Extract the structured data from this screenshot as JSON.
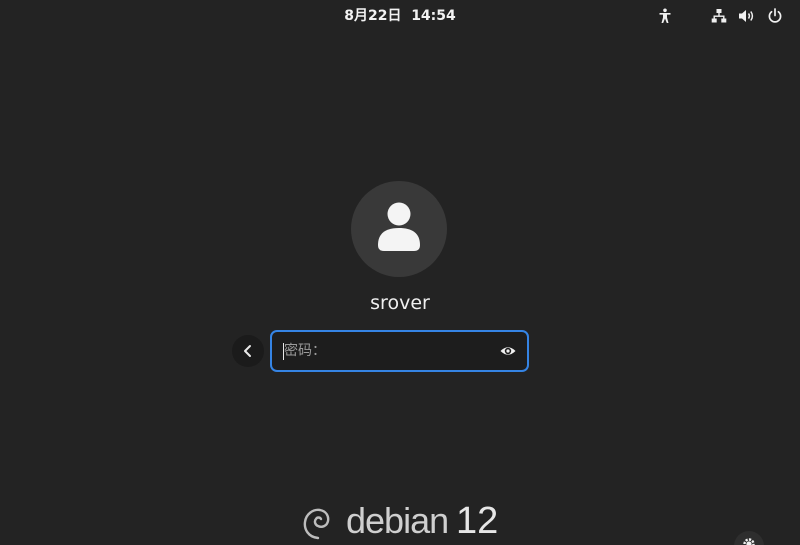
{
  "top_bar": {
    "clock": "8月22日  14:54",
    "icons": [
      "accessibility-icon",
      "network-icon",
      "volume-icon",
      "power-icon"
    ]
  },
  "login": {
    "avatar_icon": "user-icon",
    "username": "srover",
    "back_icon": "chevron-left-icon",
    "password_placeholder": "密码：",
    "password_value": "",
    "reveal_icon": "eye-icon"
  },
  "branding": {
    "logo_icon": "debian-swirl-icon",
    "name": "debian",
    "version": "12"
  },
  "session_settings_icon": "gear-icon",
  "colors": {
    "background": "#232323",
    "focus_border": "#3584e4",
    "field_background": "#1d1d1d",
    "avatar_background": "#393939"
  }
}
